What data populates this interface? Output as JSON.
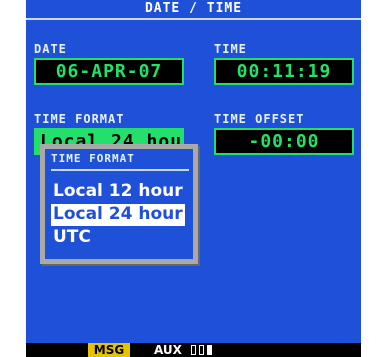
{
  "header": {
    "title": "DATE / TIME"
  },
  "date": {
    "label": "DATE",
    "value": "06-APR-07"
  },
  "time": {
    "label": "TIME",
    "value": "00:11:19"
  },
  "time_format": {
    "label": "TIME FORMAT",
    "value": "Local 24 hour"
  },
  "time_offset": {
    "label": "TIME OFFSET",
    "value": "-00:00"
  },
  "popup": {
    "title": "TIME FORMAT",
    "options": [
      "Local 12 hour",
      "Local 24 hour",
      "UTC"
    ],
    "selected": "Local 24 hour"
  },
  "status_bar": {
    "msg": "MSG",
    "aux": "AUX"
  },
  "colors": {
    "screen": "#1f50d8",
    "field_text": "#22e06a",
    "msg": "#e6c300"
  }
}
